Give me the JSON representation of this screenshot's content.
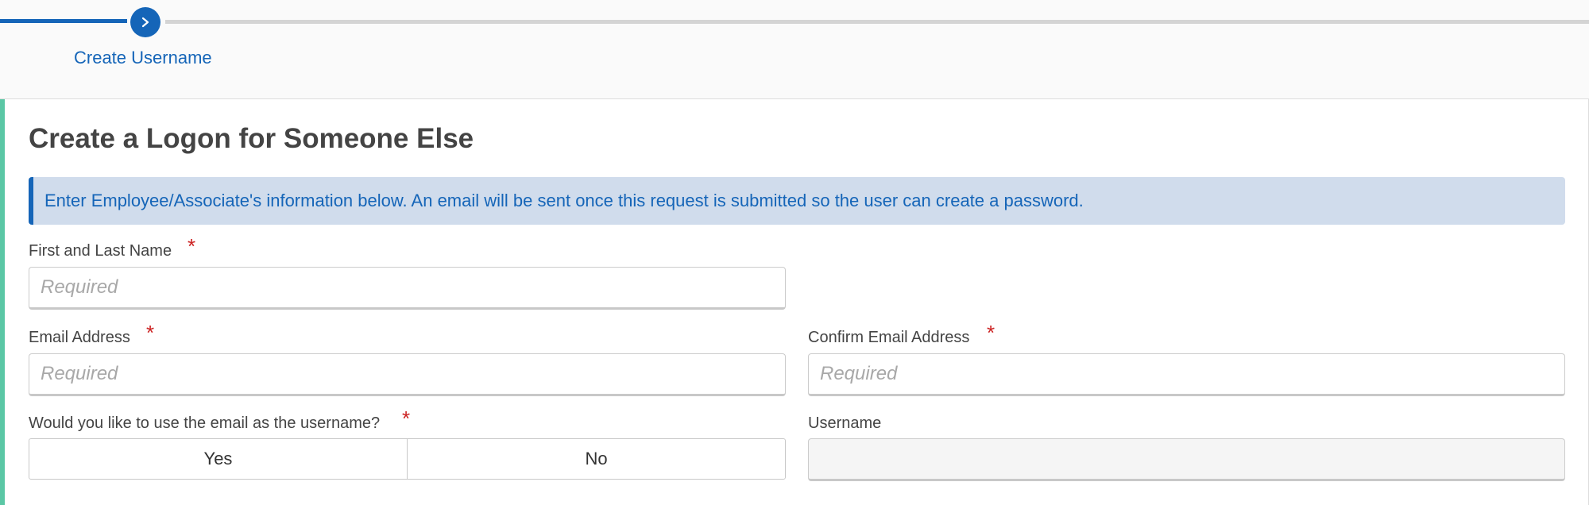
{
  "stepper": {
    "current_step_label": "Create Username",
    "current_step_icon": "chevron-right-icon",
    "accent_color": "#1565b8"
  },
  "form": {
    "title": "Create a Logon for Someone Else",
    "info_message": "Enter Employee/Associate's information below. An email will be sent once this request is submitted so the user can create a password.",
    "required_mark": "*",
    "fields": {
      "full_name": {
        "label": "First and Last Name",
        "placeholder": "Required",
        "value": ""
      },
      "email": {
        "label": "Email Address",
        "placeholder": "Required",
        "value": ""
      },
      "confirm_email": {
        "label": "Confirm Email Address",
        "placeholder": "Required",
        "value": ""
      },
      "use_email_as_username": {
        "label": "Would you like to use the email as the username?",
        "options": [
          "Yes",
          "No"
        ]
      },
      "username": {
        "label": "Username",
        "value": ""
      }
    }
  }
}
